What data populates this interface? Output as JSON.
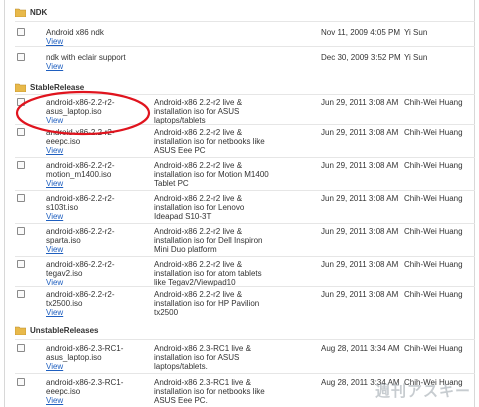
{
  "sections": [
    {
      "name": "NDK",
      "rows": [
        {
          "file": "Android x86 ndk",
          "desc": "",
          "date": "Nov 11, 2009 4:05 PM",
          "owner": "Yi Sun",
          "view": "View"
        },
        {
          "file": "ndk with eclair support",
          "desc": "",
          "date": "Dec 30, 2009 3:52 PM",
          "owner": "Yi Sun",
          "view": "View"
        }
      ]
    },
    {
      "name": "StableRelease",
      "rows": [
        {
          "file": "android-x86-2.2-r2-asus_laptop.iso",
          "desc": "Android-x86 2.2-r2 live & installation iso for ASUS laptops/tablets",
          "date": "Jun 29, 2011 3:08 AM",
          "owner": "Chih-Wei Huang",
          "view": "View"
        },
        {
          "file": "android-x86-2.2-r2-eeepc.iso",
          "desc": "Android-x86 2.2-r2 live & installation iso for netbooks like ASUS Eee PC",
          "date": "Jun 29, 2011 3:08 AM",
          "owner": "Chih-Wei Huang",
          "view": "View"
        },
        {
          "file": "android-x86-2.2-r2-motion_m1400.iso",
          "desc": "Android-x86 2.2-r2 live & installation iso for Motion M1400 Tablet PC",
          "date": "Jun 29, 2011 3:08 AM",
          "owner": "Chih-Wei Huang",
          "view": "View"
        },
        {
          "file": "android-x86-2.2-r2-s103t.iso",
          "desc": "Android-x86 2.2-r2 live & installation iso for Lenovo Ideapad S10-3T",
          "date": "Jun 29, 2011 3:08 AM",
          "owner": "Chih-Wei Huang",
          "view": "View"
        },
        {
          "file": "android-x86-2.2-r2-sparta.iso",
          "desc": "Android-x86 2.2-r2 live & installation iso for Dell Inspiron Mini Duo platform",
          "date": "Jun 29, 2011 3:08 AM",
          "owner": "Chih-Wei Huang",
          "view": "View"
        },
        {
          "file": "android-x86-2.2-r2-tegav2.iso",
          "desc": "Android-x86 2.2-r2 live & installation iso for atom tablets like Tegav2/Viewpad10",
          "date": "Jun 29, 2011 3:08 AM",
          "owner": "Chih-Wei Huang",
          "view": "View"
        },
        {
          "file": "android-x86-2.2-r2-tx2500.iso",
          "desc": "Android-x86 2.2-r2 live & installation iso for HP Pavilion tx2500",
          "date": "Jun 29, 2011 3:08 AM",
          "owner": "Chih-Wei Huang",
          "view": "View"
        }
      ]
    },
    {
      "name": "UnstableReleases",
      "rows": [
        {
          "file": "android-x86-2.3-RC1-asus_laptop.iso",
          "desc": "Android-x86 2.3-RC1 live & installation iso for ASUS laptops/tablets.",
          "date": "Aug 28, 2011 3:34 AM",
          "owner": "Chih-Wei Huang",
          "view": "View"
        },
        {
          "file": "android-x86-2.3-RC1-eeepc.iso",
          "desc": "Android-x86 2.3-RC1 live & installation iso for netbooks like ASUS Eee PC.",
          "date": "Aug 28, 2011 3:34 AM",
          "owner": "Chih-Wei Huang",
          "view": "View"
        }
      ]
    }
  ],
  "watermark": "週刊アスキー",
  "colors": {
    "link": "#1f5fbf",
    "highlight": "#e0141e",
    "folder": "#e8b94a"
  }
}
